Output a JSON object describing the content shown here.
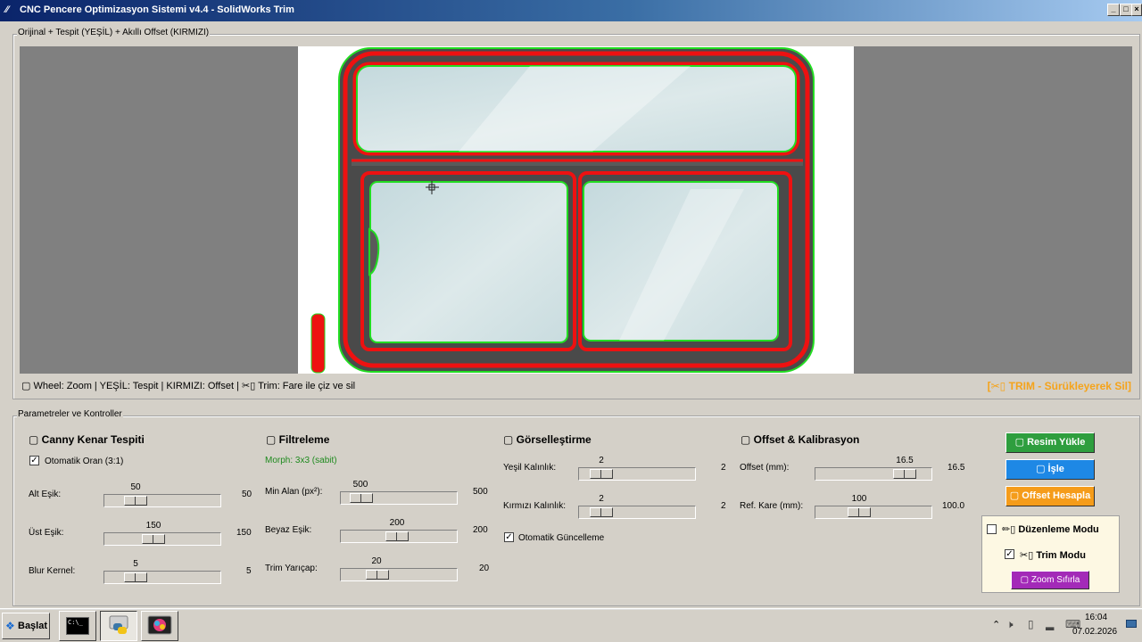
{
  "window": {
    "title": "CNC Pencere Optimizasyon Sistemi v4.4 - SolidWorks Trim",
    "icon": "feather-icon",
    "controls": [
      "minimize",
      "maximize",
      "close"
    ]
  },
  "canvas_group": {
    "legend": "Orijinal + Tespit (YEŞİL) + Akıllı Offset (KIRMIZI)",
    "hint": "▢ Wheel: Zoom | YEŞİL: Tespit | KIRMIZI: Offset | ✂▯ Trim: Fare ile çiz ve sil",
    "trim_status": "[✂▯ TRIM - Sürükleyerek Sil]",
    "colors": {
      "green": "#22dd22",
      "red": "#ee1111",
      "frame": "#4a4a4a",
      "glass": "#cddfe2"
    }
  },
  "params_group": {
    "legend": "Parametreler ve Kontroller",
    "canny": {
      "title": "▢ Canny Kenar Tespiti",
      "auto_ratio": {
        "label": "Otomatik Oran (3:1)",
        "checked": true,
        "mark": "✓"
      },
      "sliders": [
        {
          "label": "Alt Eşik:",
          "value": "50",
          "right": "50",
          "fraction": 0.28
        },
        {
          "label": "Üst Eşik:",
          "value": "150",
          "right": "150",
          "fraction": 0.42
        },
        {
          "label": "Blur Kernel:",
          "value": "5",
          "right": "5",
          "fraction": 0.28
        }
      ]
    },
    "filter": {
      "title": "▢ Filtreleme",
      "morph_note": "Morph: 3x3 (sabit)",
      "sliders": [
        {
          "label": "Min Alan (px²):",
          "value": "500",
          "right": "500",
          "fraction": 0.2
        },
        {
          "label": "Beyaz Eşik:",
          "value": "200",
          "right": "200",
          "fraction": 0.5
        },
        {
          "label": "Trim Yarıçap:",
          "value": "20",
          "right": "20",
          "fraction": 0.33
        }
      ]
    },
    "visual": {
      "title": "▢ Görselleştirme",
      "sliders": [
        {
          "label": "Yeşil Kalınlık:",
          "value": "2",
          "right": "2",
          "fraction": 0.2
        },
        {
          "label": "Kırmızı Kalınlık:",
          "value": "2",
          "right": "2",
          "fraction": 0.2
        }
      ],
      "auto_update": {
        "label": "Otomatik Güncelleme",
        "checked": true,
        "mark": "✓"
      }
    },
    "offset": {
      "title": "▢ Offset & Kalibrasyon",
      "sliders": [
        {
          "label": "Offset (mm):",
          "value": "16.5",
          "right": "16.5",
          "fraction": 0.87
        },
        {
          "label": "Ref. Kare (mm):",
          "value": "100",
          "right": "100.0",
          "fraction": 0.38
        }
      ]
    },
    "buttons": {
      "load": {
        "label": "▢ Resim Yükle",
        "color": "#2e9e3e"
      },
      "process": {
        "label": "▢ İşle",
        "color": "#1e88e5"
      },
      "calc_offset": {
        "label": "▢ Offset Hesapla",
        "color": "#f59c1a"
      }
    },
    "modes": {
      "edit": {
        "label": "✏▯ Düzenleme Modu",
        "checked": false
      },
      "trim": {
        "label": "✂▯ Trim Modu",
        "checked": true,
        "mark": "✓"
      },
      "zoom_reset": {
        "label": "▢ Zoom Sıfırla",
        "color": "#a32ab8"
      }
    }
  },
  "taskbar": {
    "start_label": "Başlat",
    "apps": [
      "cmd-icon",
      "python-icon",
      "paint-icon"
    ],
    "time": "16:04",
    "date": "07.02.2026"
  }
}
